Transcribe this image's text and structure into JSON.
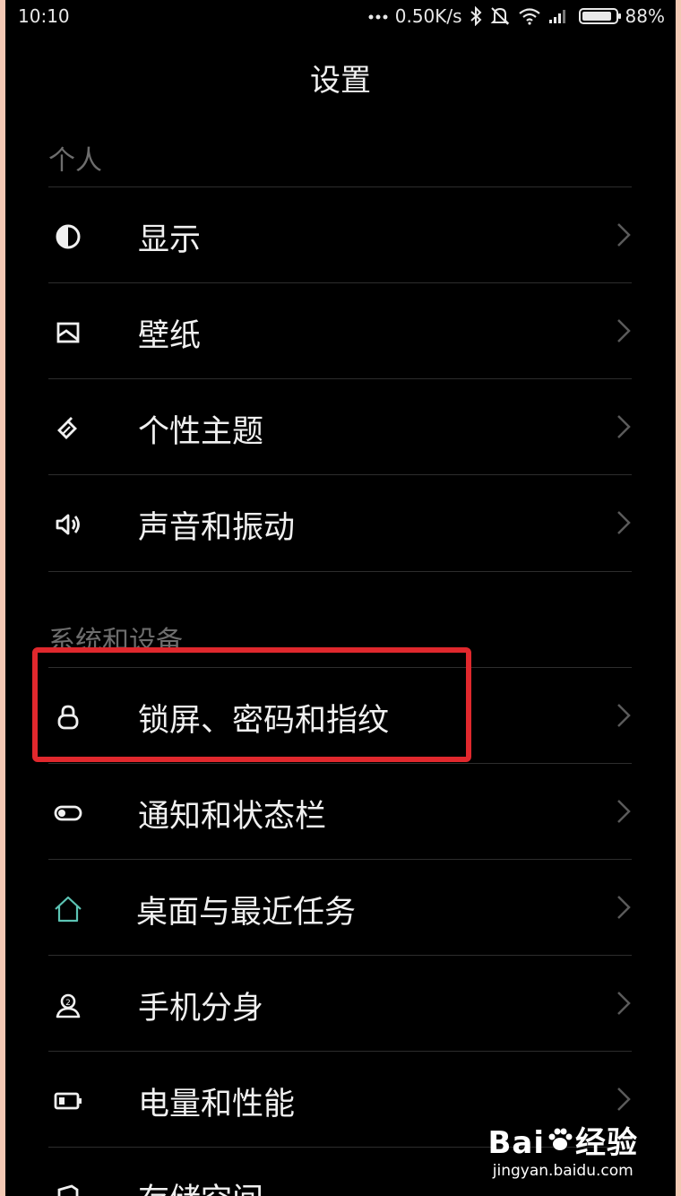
{
  "status_bar": {
    "time": "10:10",
    "network_speed": "0.50K/s",
    "battery": "88%",
    "battery_level": 0.88,
    "icons": [
      "more-dots-icon",
      "bluetooth-icon",
      "mute-icon",
      "wifi-icon",
      "signal-icon",
      "battery-icon"
    ]
  },
  "header": {
    "title": "设置"
  },
  "sections": [
    {
      "title": "个人",
      "items": [
        {
          "label": "显示",
          "icon": "display-icon"
        },
        {
          "label": "壁纸",
          "icon": "wallpaper-icon"
        },
        {
          "label": "个性主题",
          "icon": "theme-icon"
        },
        {
          "label": "声音和振动",
          "icon": "sound-icon"
        }
      ]
    },
    {
      "title": "系统和设备",
      "items": [
        {
          "label": "锁屏、密码和指纹",
          "icon": "lock-icon",
          "highlighted": true
        },
        {
          "label": "通知和状态栏",
          "icon": "toggle-icon"
        },
        {
          "label": "桌面与最近任务",
          "icon": "home-icon"
        },
        {
          "label": "手机分身",
          "icon": "second-space-icon"
        },
        {
          "label": "电量和性能",
          "icon": "battery-icon"
        },
        {
          "label": "存储空间",
          "icon": "storage-icon"
        }
      ]
    }
  ],
  "watermark": {
    "brand_a": "Bai",
    "brand_b": "经验",
    "url": "jingyan.baidu.com"
  },
  "colors": {
    "background": "#000000",
    "highlight": "#e0282d",
    "home_icon": "#5cc4b4"
  }
}
